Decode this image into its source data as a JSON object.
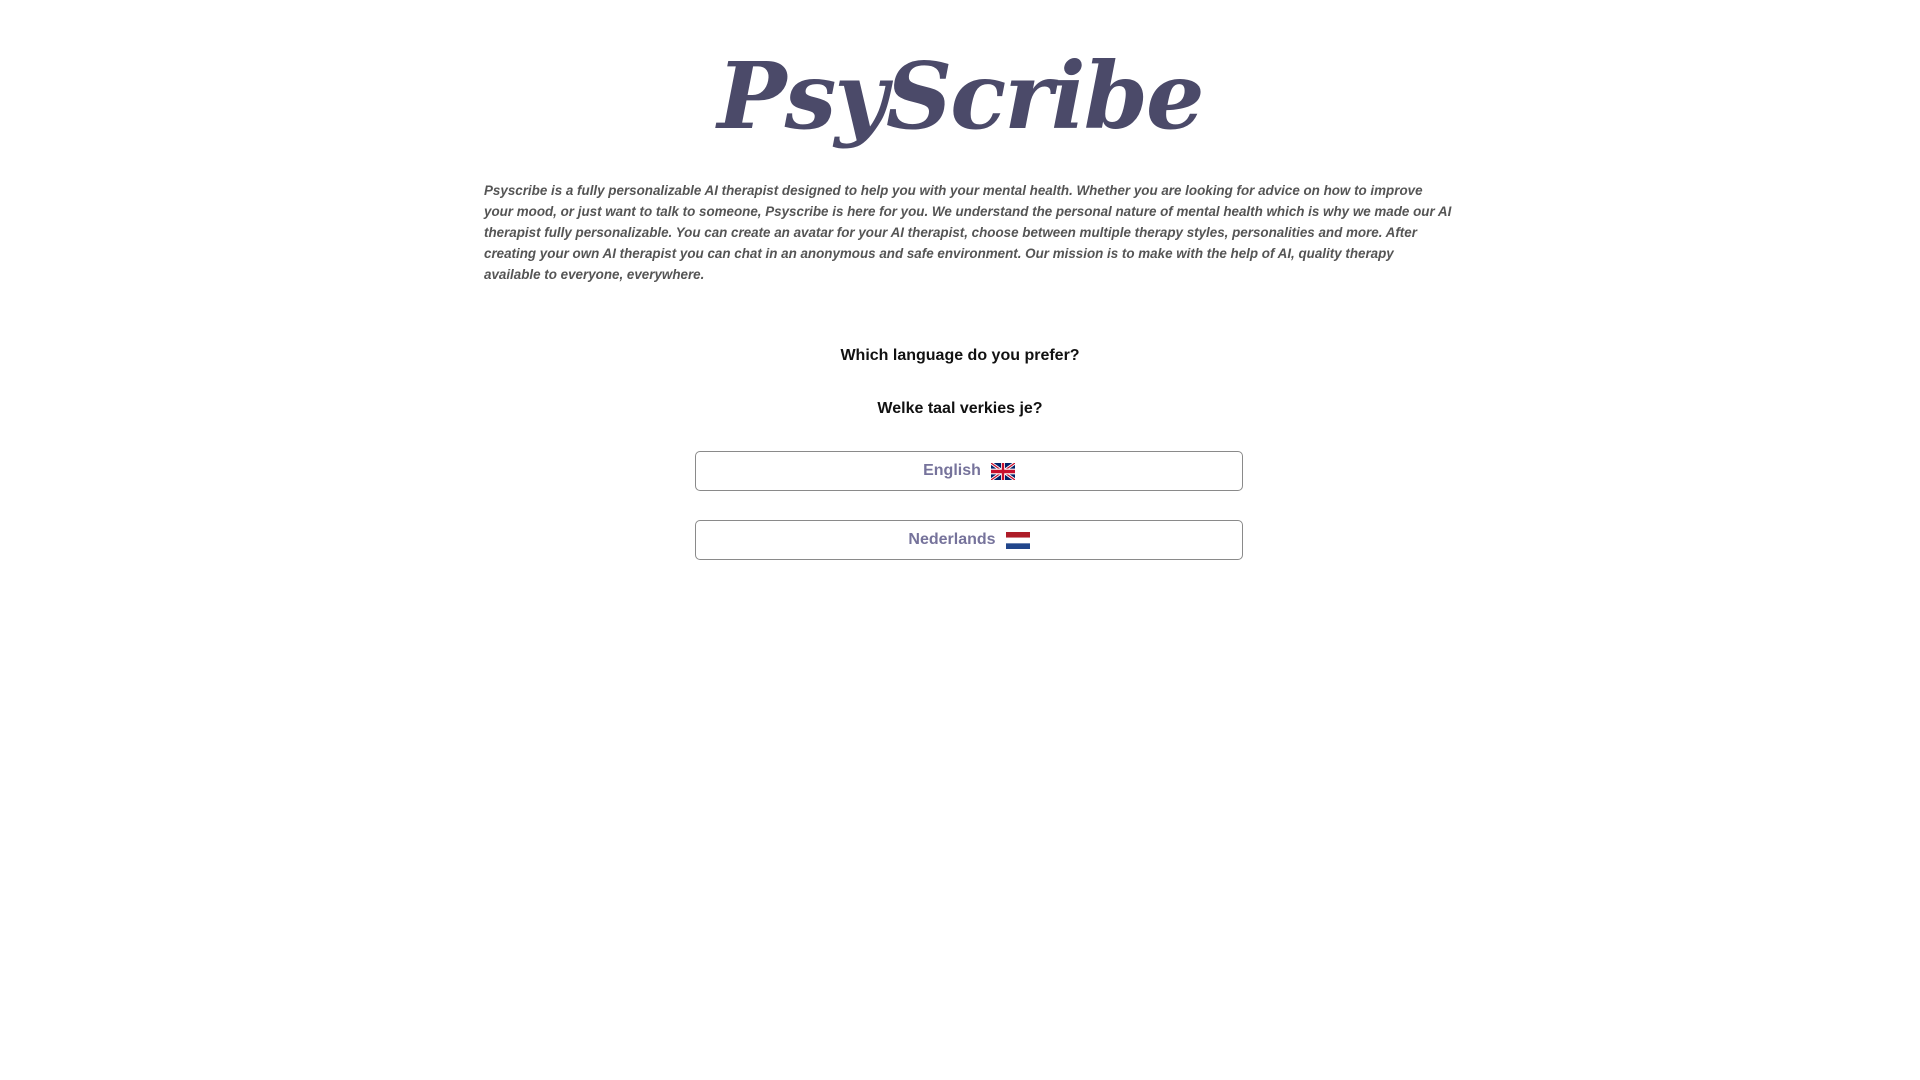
{
  "brand": {
    "logo_text": "PsyScribe"
  },
  "intro": {
    "description": "Psyscribe is a fully personalizable AI therapist designed to help you with your mental health. Whether you are looking for advice on how to improve your mood, or just want to talk to someone, Psyscribe is here for you. We understand the personal nature of mental health which is why we made our AI therapist fully personalizable. You can create an avatar for your AI therapist, choose between multiple therapy styles, personalities and more. After creating your own AI therapist you can chat in an anonymous and safe environment. Our mission is to make with the help of AI, quality therapy available to everyone, everywhere."
  },
  "language_prompt": {
    "question_en": "Which language do you prefer?",
    "question_nl": "Welke taal verkies je?"
  },
  "languages": [
    {
      "label": "English",
      "icon": "uk-flag-icon"
    },
    {
      "label": "Nederlands",
      "icon": "netherlands-flag-icon"
    }
  ],
  "colors": {
    "logo": "#4b4a69",
    "button_text": "#76739b",
    "description_text": "#555555"
  }
}
